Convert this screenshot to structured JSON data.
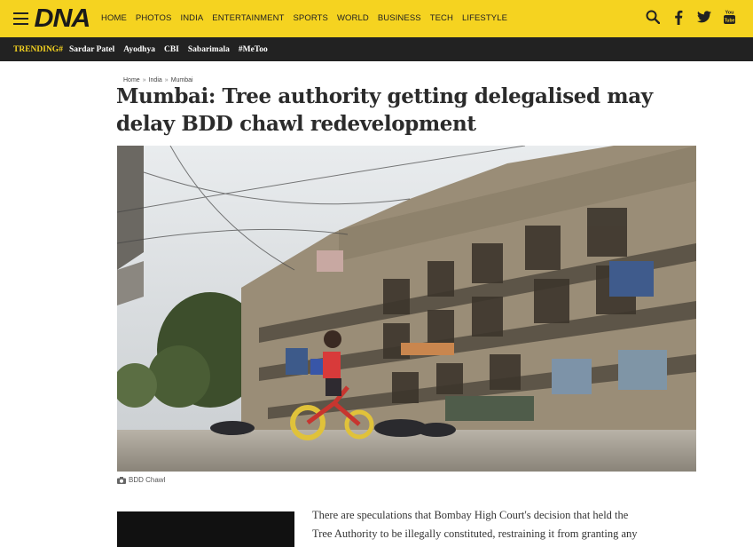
{
  "header": {
    "logo": "DNA",
    "nav": [
      "HOME",
      "PHOTOS",
      "INDIA",
      "ENTERTAINMENT",
      "SPORTS",
      "WORLD",
      "BUSINESS",
      "TECH",
      "LIFESTYLE"
    ],
    "icons": [
      "search-icon",
      "facebook-icon",
      "twitter-icon",
      "youtube-icon"
    ],
    "bg_color": "#f5d320"
  },
  "trending": {
    "label": "TRENDING#",
    "items": [
      "Sardar Patel",
      "Ayodhya",
      "CBI",
      "Sabarimala",
      "#MeToo"
    ]
  },
  "breadcrumb": [
    "Home",
    "India",
    "Mumbai"
  ],
  "article": {
    "title": "Mumbai: Tree authority getting delegalised may delay BDD chawl redevelopment",
    "image_caption": "BDD Chawl",
    "body_lines": [
      "There are speculations that Bombay High Court's decision that held the",
      "Tree Authority to be illegally constituted, restraining it from granting any"
    ]
  }
}
